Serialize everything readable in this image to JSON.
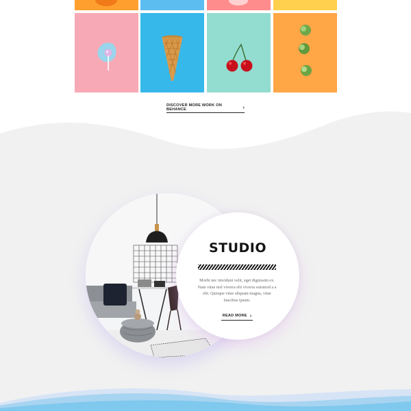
{
  "portfolio": {
    "link_label": "DISCOVER MORE WORK ON BEHANCE",
    "link_icon": "chevron-right-icon",
    "chevron": "›",
    "top_row_colors": [
      "#ff9f2e",
      "#5cbdf0",
      "#ff8c8c",
      "#ffd04d"
    ],
    "tiles": [
      {
        "name": "lollipop",
        "color": "#f7a9b5"
      },
      {
        "name": "ice-cream-cone",
        "color": "#36b8ea"
      },
      {
        "name": "cherries",
        "color": "#93ddd0"
      },
      {
        "name": "brussels-sprouts",
        "color": "#ffa646"
      }
    ]
  },
  "studio": {
    "title": "STUDIO",
    "body": "Morbi nec tincidunt velit, eget dignissim ex. Nam vitae nisl viverra elit viverra euismod a a elit. Quisque vitae aliquam magna, vitae faucibus ipsum.",
    "button_label": "READ MORE",
    "button_icon": "chevron-right-icon",
    "chevron": "›"
  },
  "colors": {
    "grey_band": "#f1f1f1",
    "accent_wave": "#7fc8ee"
  }
}
